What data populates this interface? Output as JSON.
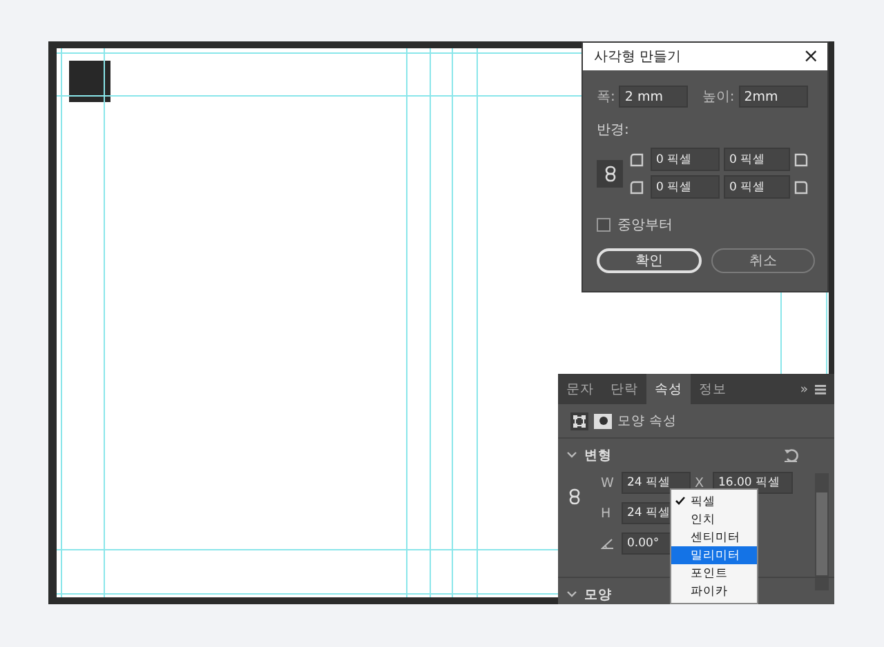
{
  "dialog": {
    "title": "사각형 만들기",
    "close": "×",
    "width_label": "폭:",
    "width_value": "2 mm",
    "height_label": "높이:",
    "height_value": "2mm",
    "radius_label": "반경:",
    "radii": [
      "0 픽셀",
      "0 픽셀",
      "0 픽셀",
      "0 픽셀"
    ],
    "center_checkbox": {
      "label": "중앙부터",
      "checked": false
    },
    "buttons": [
      {
        "label": "확인",
        "kind": "primary"
      },
      {
        "label": "취소",
        "kind": "secondary"
      }
    ]
  },
  "panel": {
    "tabs": [
      {
        "label": "문자",
        "selected": false
      },
      {
        "label": "단락",
        "selected": false
      },
      {
        "label": "속성",
        "selected": true
      },
      {
        "label": "정보",
        "selected": false
      }
    ],
    "overflow": "»",
    "heading": "모양 속성",
    "transform": {
      "title": "변형",
      "expanded": true,
      "w_label": "W",
      "w_value": "24 픽셀",
      "x_label": "X",
      "x_value": "16.00 픽셀",
      "h_label": "H",
      "h_value": "24 픽셀",
      "angle_value": "0.00°"
    },
    "shape": {
      "title": "모양",
      "expanded": true
    }
  },
  "unit_menu": [
    {
      "label": "픽셀",
      "checked": true,
      "highlighted": false
    },
    {
      "label": "인치",
      "checked": false,
      "highlighted": false
    },
    {
      "label": "센티미터",
      "checked": false,
      "highlighted": false
    },
    {
      "label": "밀리미터",
      "checked": false,
      "highlighted": true
    },
    {
      "label": "포인트",
      "checked": false,
      "highlighted": false
    },
    {
      "label": "파이카",
      "checked": false,
      "highlighted": false
    }
  ]
}
